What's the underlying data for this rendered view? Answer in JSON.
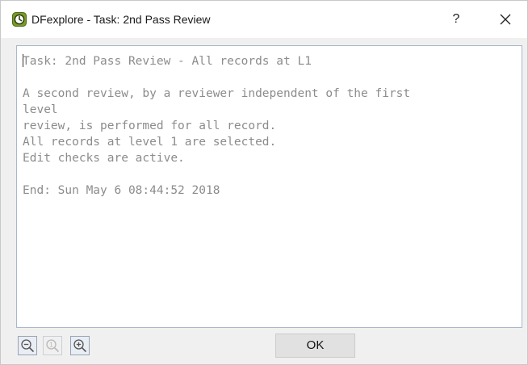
{
  "window": {
    "title": "DFexplore - Task: 2nd Pass Review",
    "help_label": "?",
    "app_icon": "dfexplore-app-icon",
    "close_icon": "close-icon"
  },
  "log": {
    "lines": [
      "Task: 2nd Pass Review - All records at L1",
      "",
      "A second review, by a reviewer independent of the first",
      "level",
      "review, is performed for all record.",
      "All records at level 1 are selected.",
      "Edit checks are active.",
      "",
      "End: Sun May 6 08:44:52 2018"
    ]
  },
  "toolbar": {
    "zoom_out_icon": "zoom-out-icon",
    "zoom_reset_icon": "zoom-reset-icon",
    "zoom_in_icon": "zoom-in-icon",
    "zoom_reset_glyph": "1",
    "ok_label": "OK"
  },
  "colors": {
    "app_icon_green": "#7a9a2c",
    "log_text": "#8c8c8c",
    "panel_border": "#a9b8cc"
  }
}
